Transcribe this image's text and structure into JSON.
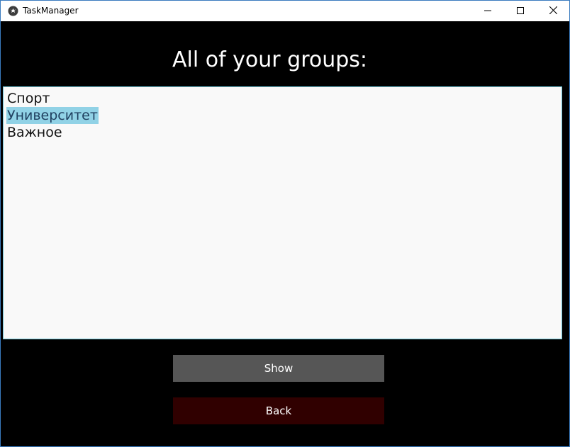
{
  "window": {
    "title": "TaskManager",
    "icon": "kivy-logo-icon"
  },
  "controls": {
    "minimize": "minimize-icon",
    "maximize": "maximize-icon",
    "close": "close-icon"
  },
  "main": {
    "heading": "All of your groups:",
    "groups": [
      {
        "label": "Спорт",
        "selected": false
      },
      {
        "label": "Университет",
        "selected": true
      },
      {
        "label": "Важное",
        "selected": false
      }
    ]
  },
  "buttons": {
    "show_label": "Show",
    "back_label": "Back"
  },
  "colors": {
    "background": "#000000",
    "list_background": "#f9f9f9",
    "selection": "#91d2e6",
    "show_button": "#565656",
    "back_button": "#300000"
  }
}
